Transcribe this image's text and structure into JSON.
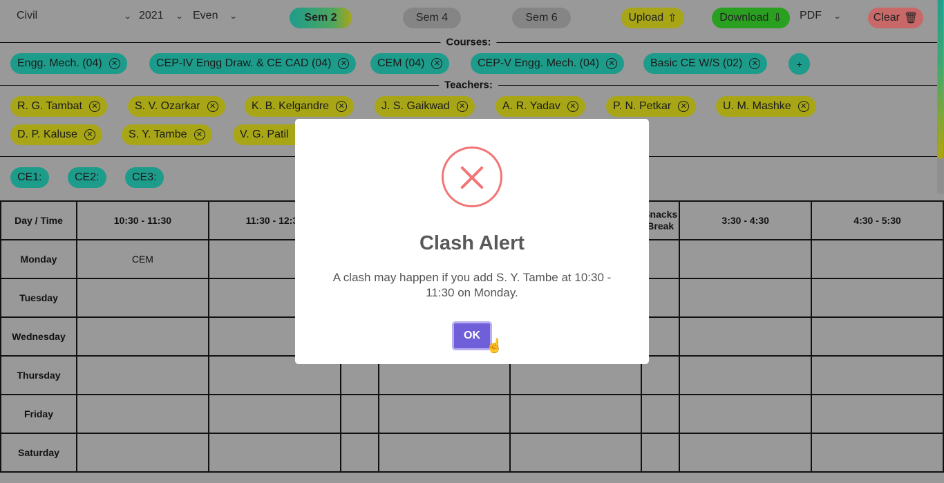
{
  "toolbar": {
    "department": "Civil",
    "year": "2021",
    "term": "Even",
    "sems": [
      "Sem 2",
      "Sem 4",
      "Sem 6"
    ],
    "upload": "Upload",
    "download": "Download",
    "format": "PDF",
    "clear": "Clear",
    "colors": {
      "active_sem": "linear teal-yellow",
      "upload": "#a8a617",
      "download": "#2aa020",
      "clear": "#c86868"
    }
  },
  "courses": {
    "label": "Courses:",
    "items": [
      "Engg. Mech. (04)",
      "CEP-IV Engg Draw. & CE CAD (04)",
      "CEM (04)",
      "CEP-V Engg. Mech. (04)",
      "Basic CE W/S (02)"
    ],
    "add": "+"
  },
  "teachers": {
    "label": "Teachers:",
    "items": [
      "R. G. Tambat",
      "S. V. Ozarkar",
      "K. B. Kelgandre",
      "J. S. Gaikwad",
      "A. R. Yadav",
      "P. N. Petkar",
      "U. M. Mashke",
      "D. P. Kaluse",
      "S. Y. Tambe",
      "V. G. Patil"
    ]
  },
  "classes": [
    "CE1:",
    "CE2:",
    "CE3:"
  ],
  "timetable": {
    "headers": [
      "Day / Time",
      "10:30 - 11:30",
      "11:30 - 12:30",
      "",
      "",
      "",
      "Snacks Break",
      "3:30 - 4:30",
      "4:30 - 5:30"
    ],
    "days": [
      "Monday",
      "Tuesday",
      "Wednesday",
      "Thursday",
      "Friday",
      "Saturday"
    ],
    "cells": {
      "Monday-10:30 - 11:30": "CEM"
    }
  },
  "modal": {
    "icon": "error-x-icon",
    "title": "Clash Alert",
    "message": "A clash may happen if you add S. Y. Tambe at 10:30 - 11:30 on Monday.",
    "ok": "OK"
  }
}
